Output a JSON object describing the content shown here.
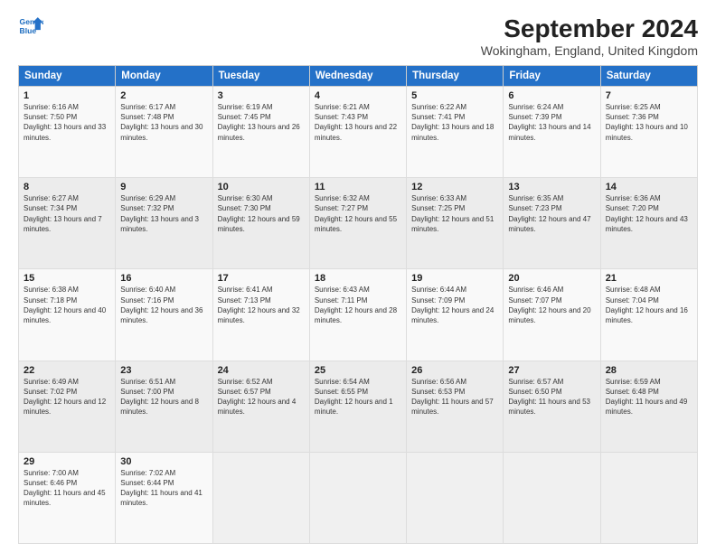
{
  "header": {
    "logo_line1": "General",
    "logo_line2": "Blue",
    "title": "September 2024",
    "subtitle": "Wokingham, England, United Kingdom"
  },
  "weekdays": [
    "Sunday",
    "Monday",
    "Tuesday",
    "Wednesday",
    "Thursday",
    "Friday",
    "Saturday"
  ],
  "weeks": [
    [
      {
        "day": "1",
        "sunrise": "Sunrise: 6:16 AM",
        "sunset": "Sunset: 7:50 PM",
        "daylight": "Daylight: 13 hours and 33 minutes."
      },
      {
        "day": "2",
        "sunrise": "Sunrise: 6:17 AM",
        "sunset": "Sunset: 7:48 PM",
        "daylight": "Daylight: 13 hours and 30 minutes."
      },
      {
        "day": "3",
        "sunrise": "Sunrise: 6:19 AM",
        "sunset": "Sunset: 7:45 PM",
        "daylight": "Daylight: 13 hours and 26 minutes."
      },
      {
        "day": "4",
        "sunrise": "Sunrise: 6:21 AM",
        "sunset": "Sunset: 7:43 PM",
        "daylight": "Daylight: 13 hours and 22 minutes."
      },
      {
        "day": "5",
        "sunrise": "Sunrise: 6:22 AM",
        "sunset": "Sunset: 7:41 PM",
        "daylight": "Daylight: 13 hours and 18 minutes."
      },
      {
        "day": "6",
        "sunrise": "Sunrise: 6:24 AM",
        "sunset": "Sunset: 7:39 PM",
        "daylight": "Daylight: 13 hours and 14 minutes."
      },
      {
        "day": "7",
        "sunrise": "Sunrise: 6:25 AM",
        "sunset": "Sunset: 7:36 PM",
        "daylight": "Daylight: 13 hours and 10 minutes."
      }
    ],
    [
      {
        "day": "8",
        "sunrise": "Sunrise: 6:27 AM",
        "sunset": "Sunset: 7:34 PM",
        "daylight": "Daylight: 13 hours and 7 minutes."
      },
      {
        "day": "9",
        "sunrise": "Sunrise: 6:29 AM",
        "sunset": "Sunset: 7:32 PM",
        "daylight": "Daylight: 13 hours and 3 minutes."
      },
      {
        "day": "10",
        "sunrise": "Sunrise: 6:30 AM",
        "sunset": "Sunset: 7:30 PM",
        "daylight": "Daylight: 12 hours and 59 minutes."
      },
      {
        "day": "11",
        "sunrise": "Sunrise: 6:32 AM",
        "sunset": "Sunset: 7:27 PM",
        "daylight": "Daylight: 12 hours and 55 minutes."
      },
      {
        "day": "12",
        "sunrise": "Sunrise: 6:33 AM",
        "sunset": "Sunset: 7:25 PM",
        "daylight": "Daylight: 12 hours and 51 minutes."
      },
      {
        "day": "13",
        "sunrise": "Sunrise: 6:35 AM",
        "sunset": "Sunset: 7:23 PM",
        "daylight": "Daylight: 12 hours and 47 minutes."
      },
      {
        "day": "14",
        "sunrise": "Sunrise: 6:36 AM",
        "sunset": "Sunset: 7:20 PM",
        "daylight": "Daylight: 12 hours and 43 minutes."
      }
    ],
    [
      {
        "day": "15",
        "sunrise": "Sunrise: 6:38 AM",
        "sunset": "Sunset: 7:18 PM",
        "daylight": "Daylight: 12 hours and 40 minutes."
      },
      {
        "day": "16",
        "sunrise": "Sunrise: 6:40 AM",
        "sunset": "Sunset: 7:16 PM",
        "daylight": "Daylight: 12 hours and 36 minutes."
      },
      {
        "day": "17",
        "sunrise": "Sunrise: 6:41 AM",
        "sunset": "Sunset: 7:13 PM",
        "daylight": "Daylight: 12 hours and 32 minutes."
      },
      {
        "day": "18",
        "sunrise": "Sunrise: 6:43 AM",
        "sunset": "Sunset: 7:11 PM",
        "daylight": "Daylight: 12 hours and 28 minutes."
      },
      {
        "day": "19",
        "sunrise": "Sunrise: 6:44 AM",
        "sunset": "Sunset: 7:09 PM",
        "daylight": "Daylight: 12 hours and 24 minutes."
      },
      {
        "day": "20",
        "sunrise": "Sunrise: 6:46 AM",
        "sunset": "Sunset: 7:07 PM",
        "daylight": "Daylight: 12 hours and 20 minutes."
      },
      {
        "day": "21",
        "sunrise": "Sunrise: 6:48 AM",
        "sunset": "Sunset: 7:04 PM",
        "daylight": "Daylight: 12 hours and 16 minutes."
      }
    ],
    [
      {
        "day": "22",
        "sunrise": "Sunrise: 6:49 AM",
        "sunset": "Sunset: 7:02 PM",
        "daylight": "Daylight: 12 hours and 12 minutes."
      },
      {
        "day": "23",
        "sunrise": "Sunrise: 6:51 AM",
        "sunset": "Sunset: 7:00 PM",
        "daylight": "Daylight: 12 hours and 8 minutes."
      },
      {
        "day": "24",
        "sunrise": "Sunrise: 6:52 AM",
        "sunset": "Sunset: 6:57 PM",
        "daylight": "Daylight: 12 hours and 4 minutes."
      },
      {
        "day": "25",
        "sunrise": "Sunrise: 6:54 AM",
        "sunset": "Sunset: 6:55 PM",
        "daylight": "Daylight: 12 hours and 1 minute."
      },
      {
        "day": "26",
        "sunrise": "Sunrise: 6:56 AM",
        "sunset": "Sunset: 6:53 PM",
        "daylight": "Daylight: 11 hours and 57 minutes."
      },
      {
        "day": "27",
        "sunrise": "Sunrise: 6:57 AM",
        "sunset": "Sunset: 6:50 PM",
        "daylight": "Daylight: 11 hours and 53 minutes."
      },
      {
        "day": "28",
        "sunrise": "Sunrise: 6:59 AM",
        "sunset": "Sunset: 6:48 PM",
        "daylight": "Daylight: 11 hours and 49 minutes."
      }
    ],
    [
      {
        "day": "29",
        "sunrise": "Sunrise: 7:00 AM",
        "sunset": "Sunset: 6:46 PM",
        "daylight": "Daylight: 11 hours and 45 minutes."
      },
      {
        "day": "30",
        "sunrise": "Sunrise: 7:02 AM",
        "sunset": "Sunset: 6:44 PM",
        "daylight": "Daylight: 11 hours and 41 minutes."
      },
      null,
      null,
      null,
      null,
      null
    ]
  ]
}
